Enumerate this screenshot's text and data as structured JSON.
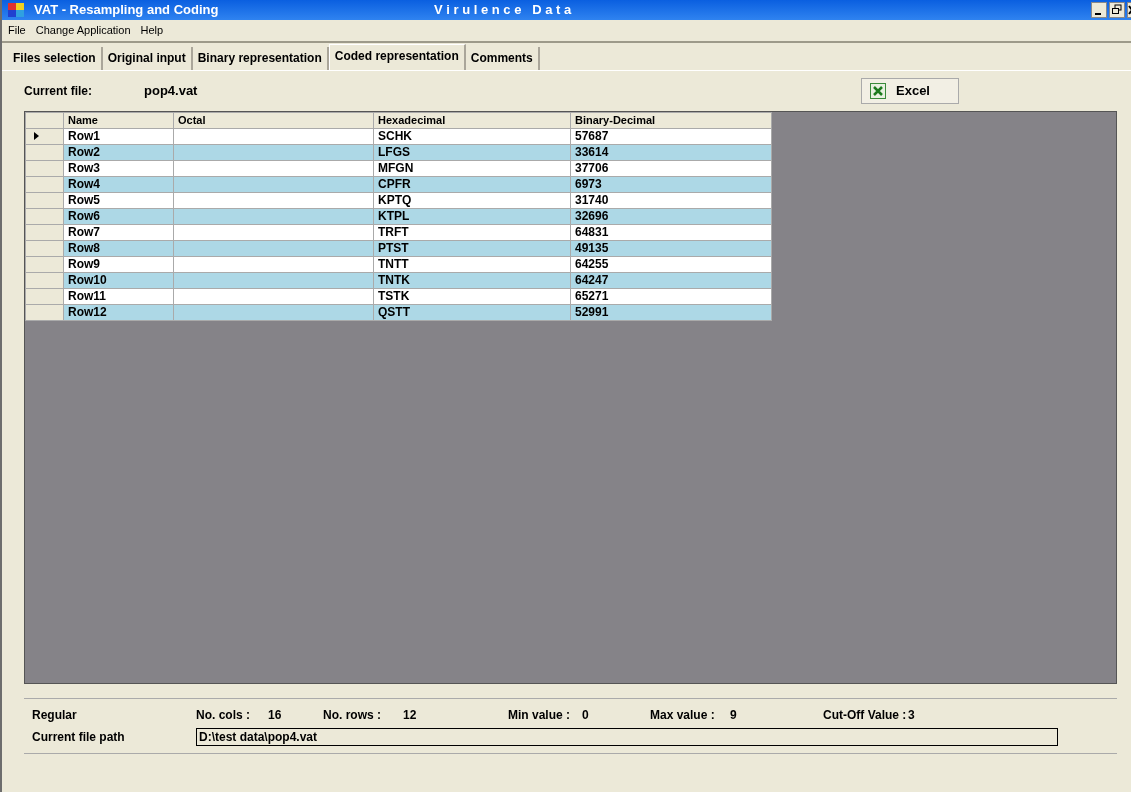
{
  "window": {
    "title": "VAT  -  Resampling and Coding",
    "subtitle": "V i r u l e n c e   D a t a"
  },
  "menu": [
    "File",
    "Change Application",
    "Help"
  ],
  "tabs": [
    {
      "label": "Files selection",
      "selected": false
    },
    {
      "label": "Original input",
      "selected": false
    },
    {
      "label": "Binary representation",
      "selected": false
    },
    {
      "label": "Coded representation",
      "selected": true
    },
    {
      "label": "Comments",
      "selected": false
    }
  ],
  "current_file": {
    "label": "Current file:",
    "value": "pop4.vat"
  },
  "excel_button": "Excel",
  "table": {
    "columns": [
      "Name",
      "Octal",
      "Hexadecimal",
      "Binary-Decimal"
    ],
    "rows": [
      {
        "current": true,
        "name": "Row1",
        "hexadecimal": "SCHK",
        "binary_decimal": "57687"
      },
      {
        "current": false,
        "name": "Row2",
        "hexadecimal": "LFGS",
        "binary_decimal": "33614"
      },
      {
        "current": false,
        "name": "Row3",
        "hexadecimal": "MFGN",
        "binary_decimal": "37706"
      },
      {
        "current": false,
        "name": "Row4",
        "hexadecimal": "CPFR",
        "binary_decimal": "6973"
      },
      {
        "current": false,
        "name": "Row5",
        "hexadecimal": "KPTQ",
        "binary_decimal": "31740"
      },
      {
        "current": false,
        "name": "Row6",
        "hexadecimal": "KTPL",
        "binary_decimal": "32696"
      },
      {
        "current": false,
        "name": "Row7",
        "hexadecimal": "TRFT",
        "binary_decimal": "64831"
      },
      {
        "current": false,
        "name": "Row8",
        "hexadecimal": "PTST",
        "binary_decimal": "49135"
      },
      {
        "current": false,
        "name": "Row9",
        "hexadecimal": "TNTT",
        "binary_decimal": "64255"
      },
      {
        "current": false,
        "name": "Row10",
        "hexadecimal": "TNTK",
        "binary_decimal": "64247"
      },
      {
        "current": false,
        "name": "Row11",
        "hexadecimal": "TSTK",
        "binary_decimal": "65271"
      },
      {
        "current": false,
        "name": "Row12",
        "hexadecimal": "QSTT",
        "binary_decimal": "52991"
      }
    ]
  },
  "summary": {
    "mode": "Regular",
    "stats": [
      {
        "label": "No. cols :",
        "value": "16"
      },
      {
        "label": "No. rows :",
        "value": "12"
      },
      {
        "label": "Min value :",
        "value": "0"
      },
      {
        "label": "Max value :",
        "value": "9"
      },
      {
        "label": "Cut-Off Value :",
        "value": "3"
      }
    ],
    "path_label": "Current file path",
    "path": "D:\\test data\\pop4.vat"
  }
}
